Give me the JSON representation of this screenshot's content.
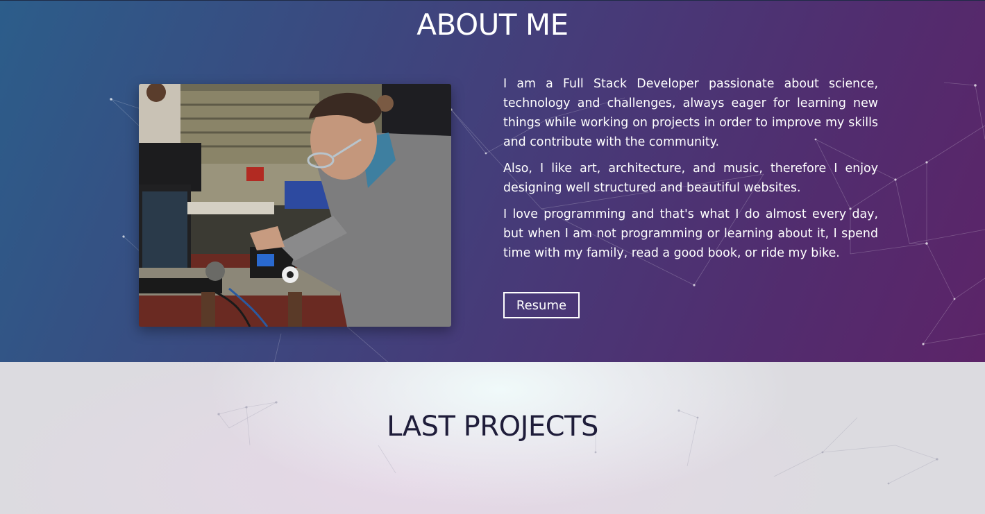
{
  "about": {
    "title": "ABOUT ME",
    "photo_alt": "Person assembling a small robot at a workbench",
    "paragraphs": [
      "I am a Full Stack Developer passionate about science, technology and challenges, always eager for learning new things while working on projects in order to improve my skills and contribute with the community.",
      "Also, I like art, architecture, and music, therefore I enjoy designing well structured and beautiful websites.",
      "I love programming and that's what I do almost every day, but when I am not programming or learning about it, I spend time with my family, read a good book, or ride my bike."
    ],
    "resume_label": "Resume"
  },
  "projects": {
    "title": "LAST PROJECTS"
  },
  "colors": {
    "about_gradient_start": "#2c5d8a",
    "about_gradient_end": "#5c2468",
    "projects_bg": "#dcdbe0",
    "projects_title": "#1f1d3a",
    "text_light": "#ffffff"
  }
}
